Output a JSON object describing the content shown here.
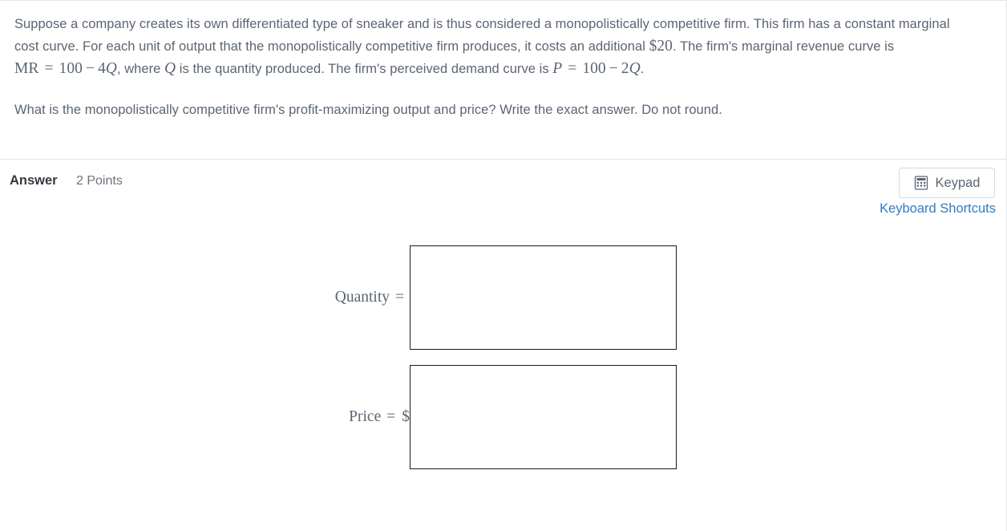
{
  "question": {
    "paragraph1_parts": [
      {
        "type": "text",
        "value": "Suppose a company creates its own differentiated type of sneaker and is thus considered a monopolistically competitive firm. This firm has a constant marginal cost curve. For each unit of output that the monopolistically competitive firm produces, it costs an additional "
      },
      {
        "type": "math",
        "value": "$20"
      },
      {
        "type": "text",
        "value": ". The firm's marginal revenue curve is "
      },
      {
        "type": "math",
        "value": "MR = 100 − 4Q"
      },
      {
        "type": "text",
        "value": ", where "
      },
      {
        "type": "math",
        "value": "Q"
      },
      {
        "type": "text",
        "value": " is the quantity produced. The firm's perceived demand curve is "
      },
      {
        "type": "math",
        "value": "P = 100 − 2Q"
      },
      {
        "type": "text",
        "value": "."
      }
    ],
    "paragraph2": "What is the monopolistically competitive firm's profit-maximizing output and price? Write the exact answer. Do not round.",
    "math": {
      "cost_amount": "$20",
      "mr_label": "MR",
      "mr_equals": "=",
      "mr_intercept": "100",
      "mr_minus": "−",
      "mr_slope": "4",
      "mr_var": "Q",
      "quantity_var": "Q",
      "p_label": "P",
      "p_equals": "=",
      "p_intercept": "100",
      "p_minus": "−",
      "p_slope": "2",
      "p_var": "Q",
      "period": ".",
      "comma_after_mr": ",",
      "text_where": ", where ",
      "text_is_quantity": " is the quantity produced. The firm's perceived demand curve is ",
      "text_lead": "Suppose a company creates its own differentiated type of sneaker and is thus considered a monopolistically competitive firm. This firm has a constant marginal cost curve. For each unit of output that the monopolistically competitive firm produces, it costs an additional ",
      "text_after_cost": ". The firm's marginal revenue curve is "
    }
  },
  "answer_section": {
    "title": "Answer",
    "points": "2 Points",
    "keypad_button_label": "Keypad",
    "keypad_icon": "calculator-keypad-icon",
    "keyboard_shortcuts_label": "Keyboard Shortcuts",
    "fields": [
      {
        "id": "quantity",
        "label_text": "Quantity",
        "equals": "=",
        "prefix": "",
        "value": "",
        "placeholder": ""
      },
      {
        "id": "price",
        "label_text": "Price",
        "equals": "=",
        "prefix": "$",
        "value": "",
        "placeholder": ""
      }
    ]
  },
  "colors": {
    "body_text": "#5b6573",
    "heading_text": "#343a40",
    "link": "#2e7cc4",
    "divider": "#e2e4e7",
    "box_border": "#1a1a1a",
    "button_border": "#cfd9e3"
  }
}
